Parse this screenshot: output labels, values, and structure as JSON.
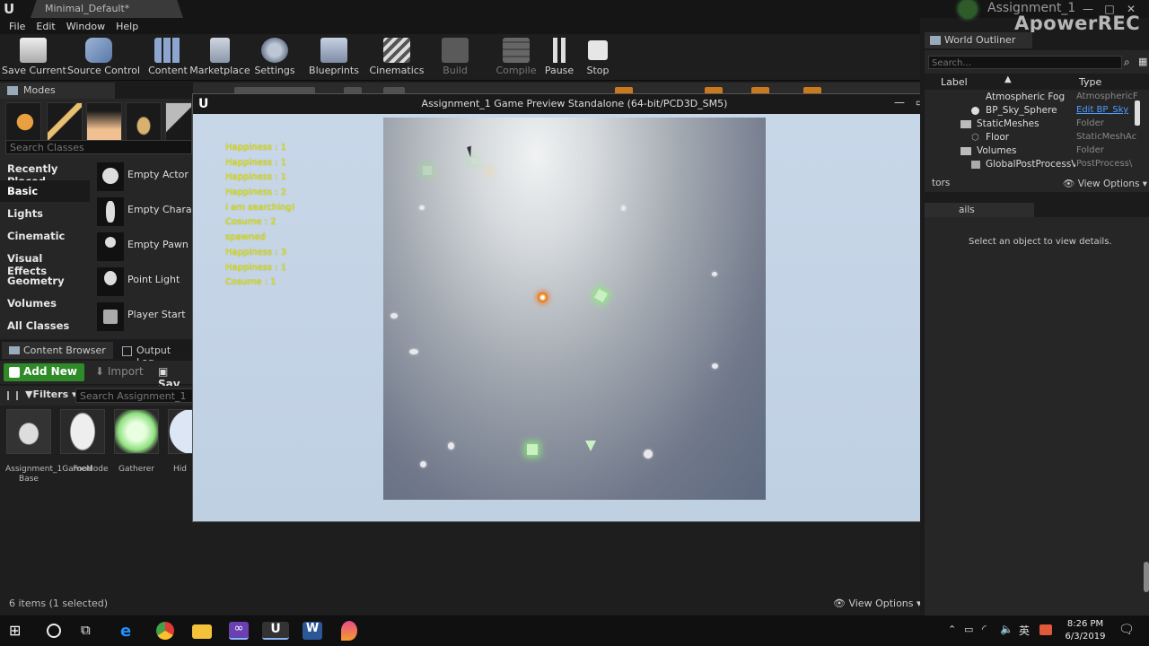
{
  "app": {
    "document_tab": "Minimal_Default*",
    "project_name": "Assignment_1",
    "recorder_watermark": "ApowerREC"
  },
  "menu": [
    "File",
    "Edit",
    "Window",
    "Help"
  ],
  "toolbar": [
    {
      "label": "Save Current",
      "icon": "save-icon"
    },
    {
      "label": "Source Control",
      "icon": "source-control-icon"
    },
    {
      "label": "Content",
      "icon": "content-icon"
    },
    {
      "label": "Marketplace",
      "icon": "marketplace-icon"
    },
    {
      "label": "Settings",
      "icon": "settings-icon"
    },
    {
      "label": "Blueprints",
      "icon": "blueprints-icon"
    },
    {
      "label": "Cinematics",
      "icon": "cinematics-icon"
    },
    {
      "label": "Build",
      "icon": "build-icon"
    },
    {
      "label": "Compile",
      "icon": "compile-icon"
    },
    {
      "label": "Pause",
      "icon": "pause-icon"
    },
    {
      "label": "Stop",
      "icon": "stop-icon"
    }
  ],
  "modes": {
    "tab_label": "Modes",
    "search_placeholder": "Search Classes",
    "categories": [
      "Recently Placed",
      "Basic",
      "Lights",
      "Cinematic",
      "Visual Effects",
      "Geometry",
      "Volumes",
      "All Classes"
    ],
    "active_category": "Basic",
    "items": [
      "Empty Actor",
      "Empty Charact",
      "Empty Pawn",
      "Point Light",
      "Player Start"
    ]
  },
  "content_browser": {
    "tab_label": "Content Browser",
    "output_log_label": "Output Log",
    "add_new": "Add New",
    "import": "Import",
    "save": "Sav",
    "filters": "Filters",
    "search_placeholder": "Search Assignment_1",
    "assets": [
      "Assignment_1GameMode Base",
      "Food",
      "Gatherer",
      "Hid"
    ],
    "item_count": "6 items (1 selected)",
    "view_options": "View Options"
  },
  "game_preview": {
    "title": "Assignment_1 Game Preview Standalone (64-bit/PCD3D_SM5)",
    "log_lines": [
      "Happiness : 1",
      "Happiness : 1",
      "Happiness : 1",
      "Happiness : 2",
      "I am searching!",
      "Cosume : 2",
      "spawned",
      "Happiness : 3",
      "Happiness : 1",
      "Cosume : 1"
    ]
  },
  "world_outliner": {
    "tab_label": "World Outliner",
    "search_placeholder": "Search...",
    "col_label": "Label",
    "col_type": "Type",
    "rows": [
      {
        "label": "Atmospheric Fog",
        "type": "AtmosphericF"
      },
      {
        "label": "BP_Sky_Sphere",
        "type": "Edit BP_Sky"
      },
      {
        "label": "StaticMeshes",
        "type": "Folder"
      },
      {
        "label": "Floor",
        "type": "StaticMeshAc"
      },
      {
        "label": "Volumes",
        "type": "Folder"
      },
      {
        "label": "GlobalPostProcessVo",
        "type": "PostProcess\\"
      }
    ],
    "actors_label": "tors",
    "view_options": "View Options"
  },
  "details": {
    "tab_label": "ails",
    "hint": "Select an object to view details."
  },
  "taskbar": {
    "time": "8:26 PM",
    "date": "6/3/2019",
    "ime": "英"
  }
}
